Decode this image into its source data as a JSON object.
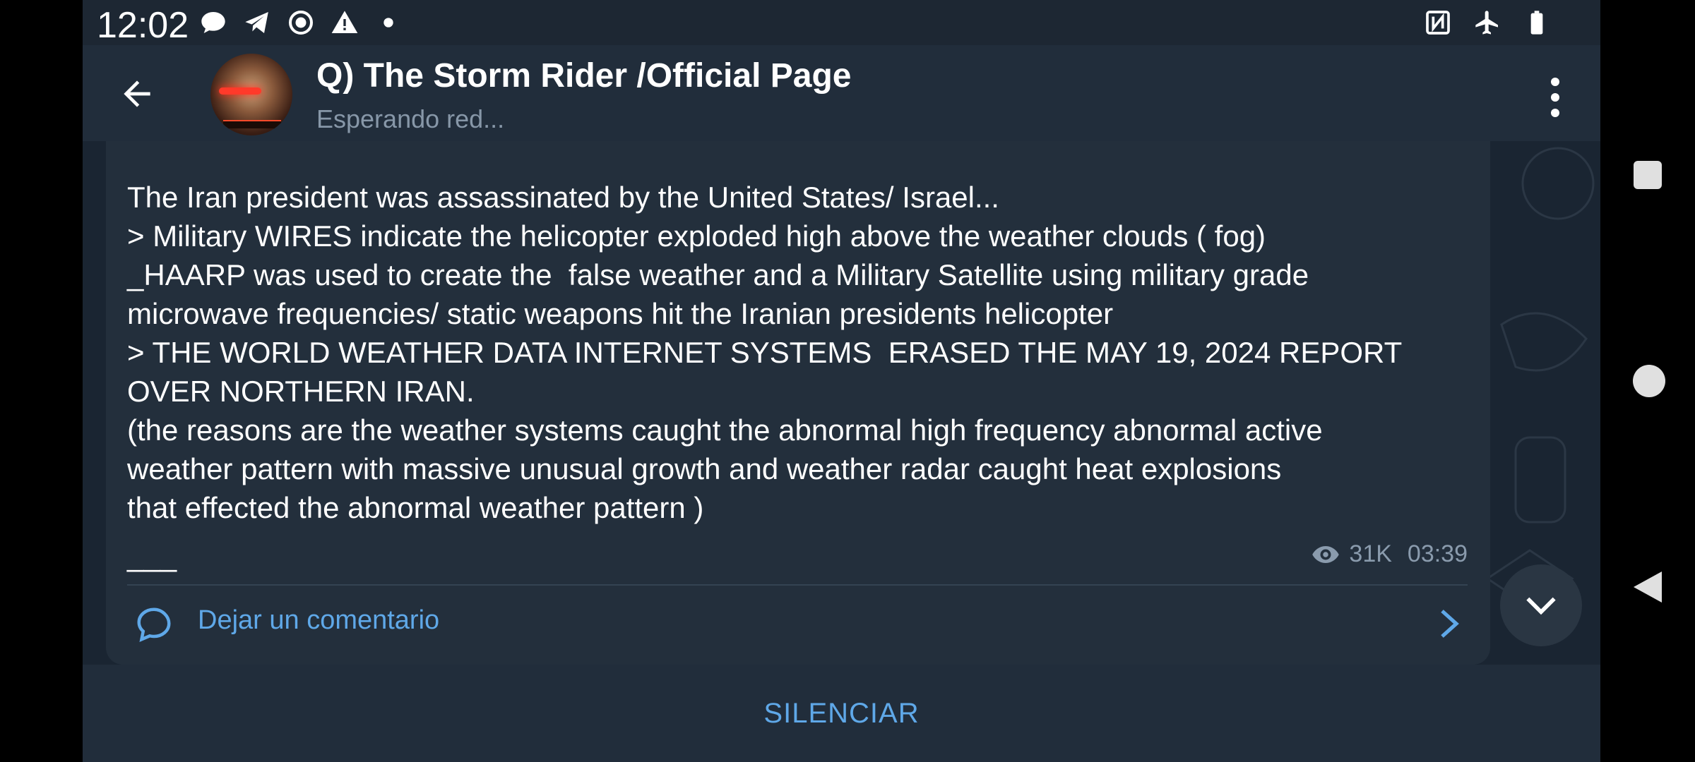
{
  "status_bar": {
    "time": "12:02",
    "left_icons": [
      "chat-bubble-icon",
      "telegram-icon",
      "record-icon",
      "warning-icon",
      "dot-icon"
    ],
    "right_icons": [
      "nfc-icon",
      "airplane-mode-icon",
      "battery-icon"
    ]
  },
  "header": {
    "title": "Q) The Storm Rider /Official Page",
    "status": "Esperando red..."
  },
  "message": {
    "text": "The Iran president was assassinated by the United States/ Israel...\n> Military WIRES indicate the helicopter exploded high above the weather clouds ( fog)\n_HAARP was used to create the  false weather and a Military Satellite using military grade\nmicrowave frequencies/ static weapons hit the Iranian presidents helicopter\n> THE WORLD WEATHER DATA INTERNET SYSTEMS  ERASED THE MAY 19, 2024 REPORT\nOVER NORTHERN IRAN.\n(the reasons are the weather systems caught the abnormal high frequency abnormal active\nweather pattern with massive unusual growth and weather radar caught heat explosions\nthat effected the abnormal weather pattern )",
    "signature": "___",
    "views": "31K",
    "time": "03:39",
    "comment_label": "Dejar un comentario"
  },
  "bottom_bar": {
    "mute_label": "SILENCIAR"
  },
  "colors": {
    "accent": "#5fa8e8",
    "background": "#1d2733",
    "bubble": "#232f3c",
    "muted_text": "#8797a8"
  }
}
